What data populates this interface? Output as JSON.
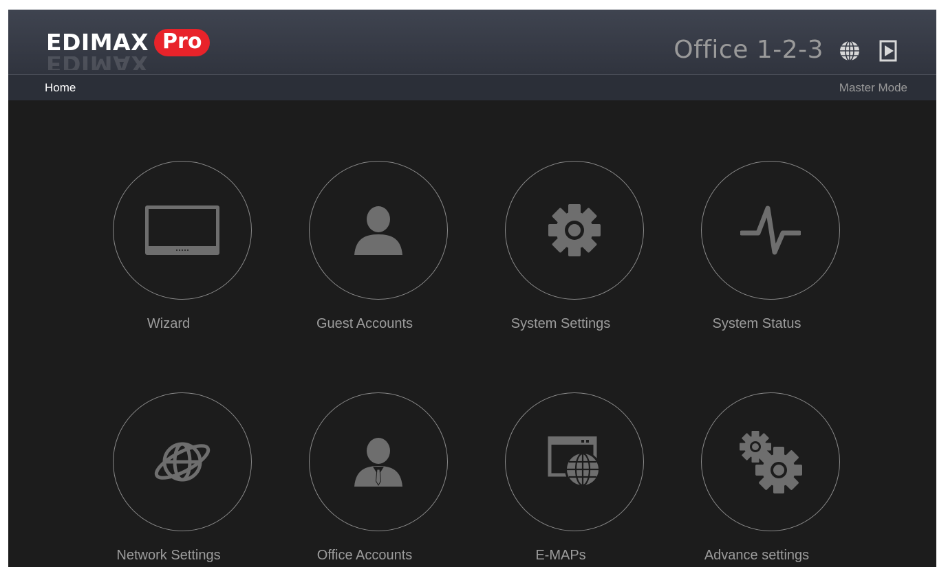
{
  "header": {
    "logo_text": "EDIMAX",
    "logo_badge": "Pro",
    "device_name": "Office 1-2-3",
    "icons": [
      "globe-icon",
      "logout-icon"
    ]
  },
  "breadcrumb": "Home",
  "mode": "Master Mode",
  "tiles": [
    {
      "label": "Wizard",
      "icon": "monitor-icon"
    },
    {
      "label": "Guest Accounts",
      "icon": "user-icon"
    },
    {
      "label": "System Settings",
      "icon": "gear-icon"
    },
    {
      "label": "System Status",
      "icon": "pulse-icon"
    },
    {
      "label": "Network Settings",
      "icon": "network-globe-icon"
    },
    {
      "label": "Office Accounts",
      "icon": "office-user-icon"
    },
    {
      "label": "E-MAPs",
      "icon": "web-map-icon"
    },
    {
      "label": "Advance settings",
      "icon": "gears-icon"
    }
  ],
  "colors": {
    "background": "#1c1c1c",
    "header": "#363a45",
    "icon_gray": "#6e6e6e",
    "brand_red": "#e8232a"
  }
}
